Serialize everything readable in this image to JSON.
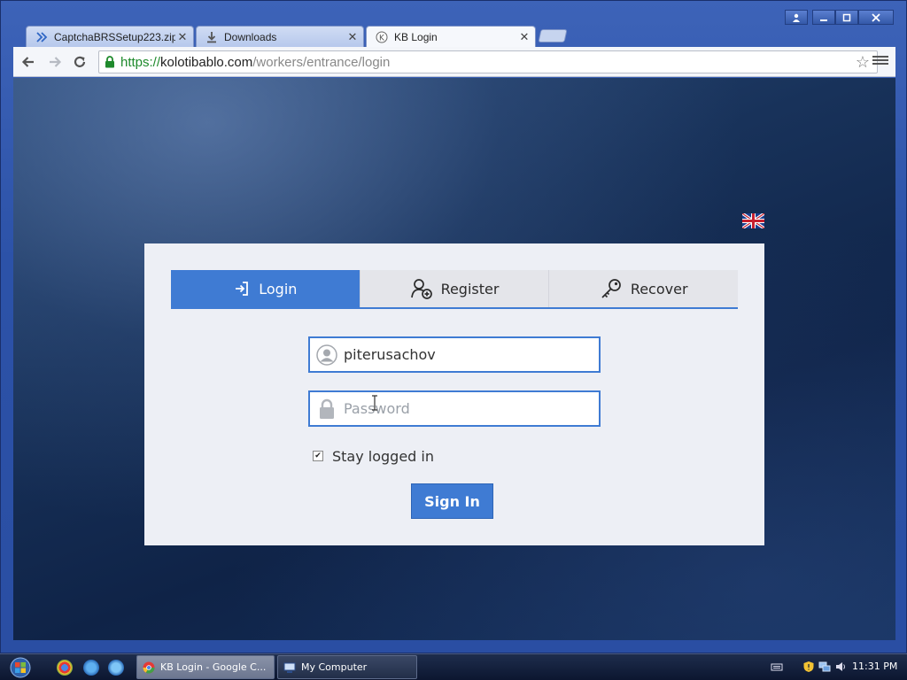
{
  "browser": {
    "tabs": [
      {
        "label": "CaptchaBRSSetup223.zip -",
        "icon": "double-chevron-icon"
      },
      {
        "label": "Downloads",
        "icon": "download-icon"
      },
      {
        "label": "KB Login",
        "icon": "kb-favicon"
      }
    ],
    "url": {
      "scheme": "https://",
      "host": "kolotibablo.com",
      "path": "/workers/entrance/login"
    },
    "window_controls": [
      "user",
      "minimize",
      "maximize",
      "close"
    ]
  },
  "page": {
    "language_flag": "uk-flag",
    "auth_tabs": [
      {
        "label": "Login",
        "icon": "login-arrow-icon",
        "active": true
      },
      {
        "label": "Register",
        "icon": "add-user-icon",
        "active": false
      },
      {
        "label": "Recover",
        "icon": "key-icon",
        "active": false
      }
    ],
    "username": {
      "value": "piterusachov",
      "placeholder": ""
    },
    "password": {
      "value": "",
      "placeholder": "Password"
    },
    "stay_logged_in": {
      "label": "Stay logged in",
      "checked": true
    },
    "sign_in_label": "Sign In",
    "accent_color": "#3f7bd3"
  },
  "taskbar": {
    "tasks": [
      {
        "label": "KB Login - Google C...",
        "active": true
      },
      {
        "label": "My Computer",
        "active": false
      }
    ],
    "clock": "11:31 PM"
  }
}
